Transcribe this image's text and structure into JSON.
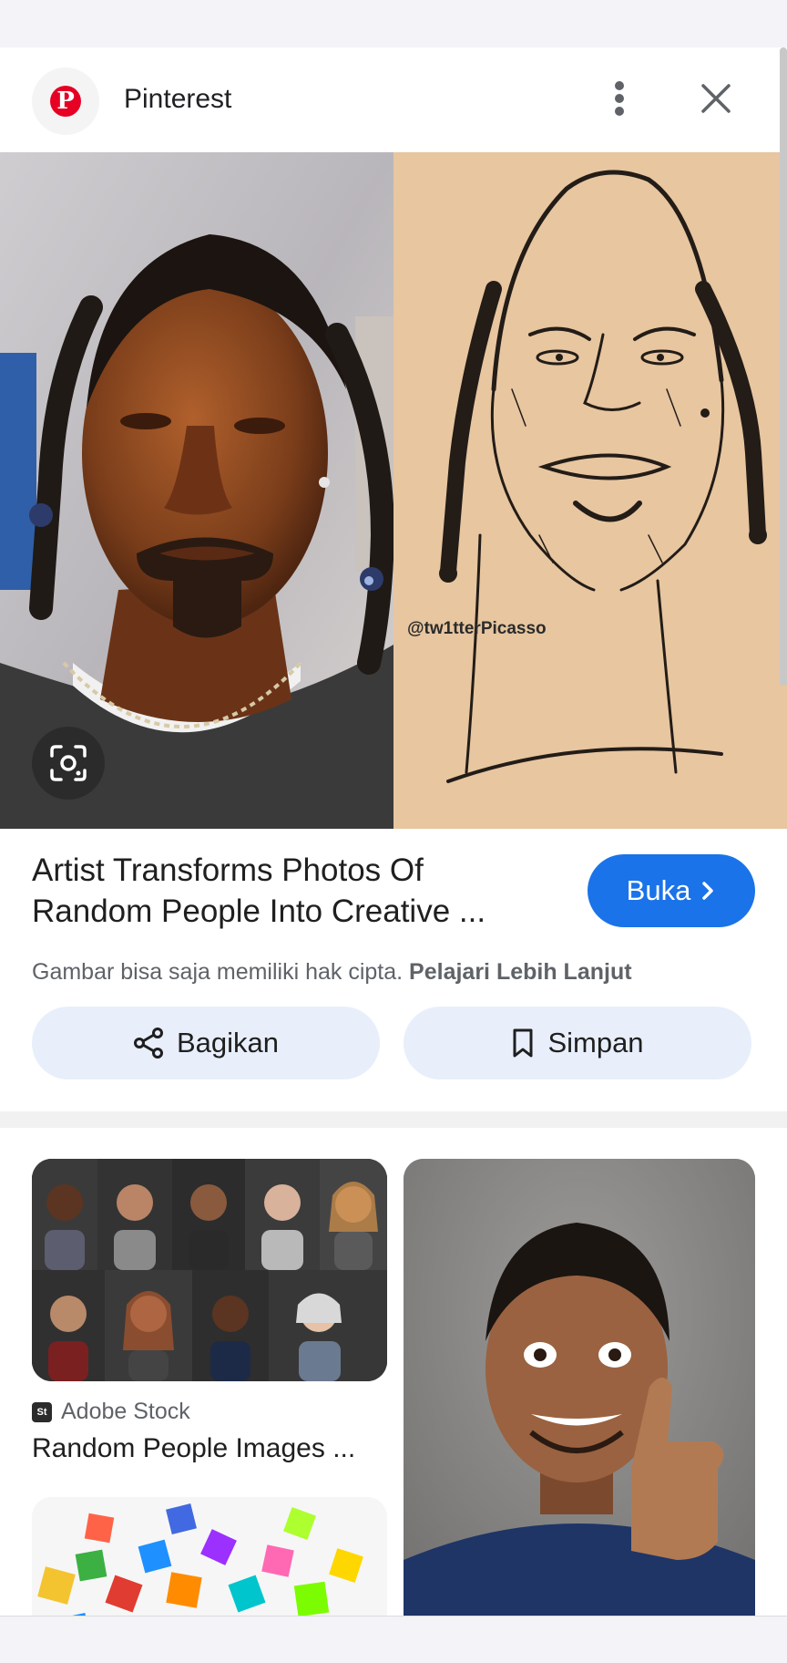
{
  "header": {
    "site_name": "Pinterest",
    "logo_letter": "P"
  },
  "hero": {
    "watermark": "@tw1tterPicasso"
  },
  "result": {
    "title_line1": "Artist Transforms Photos Of",
    "title_line2": "Random People Into Creative ...",
    "open_label": "Buka",
    "copyright_text": "Gambar bisa saja memiliki hak cipta.",
    "learn_more": "Pelajari Lebih Lanjut"
  },
  "actions": {
    "share_label": "Bagikan",
    "save_label": "Simpan"
  },
  "related": {
    "card1_source": "Adobe Stock",
    "card1_source_icon": "St",
    "card1_title": "Random People Images ..."
  },
  "colors": {
    "primary": "#1a73e8",
    "pinterest_red": "#e60023",
    "chip_bg": "#e8effb"
  }
}
